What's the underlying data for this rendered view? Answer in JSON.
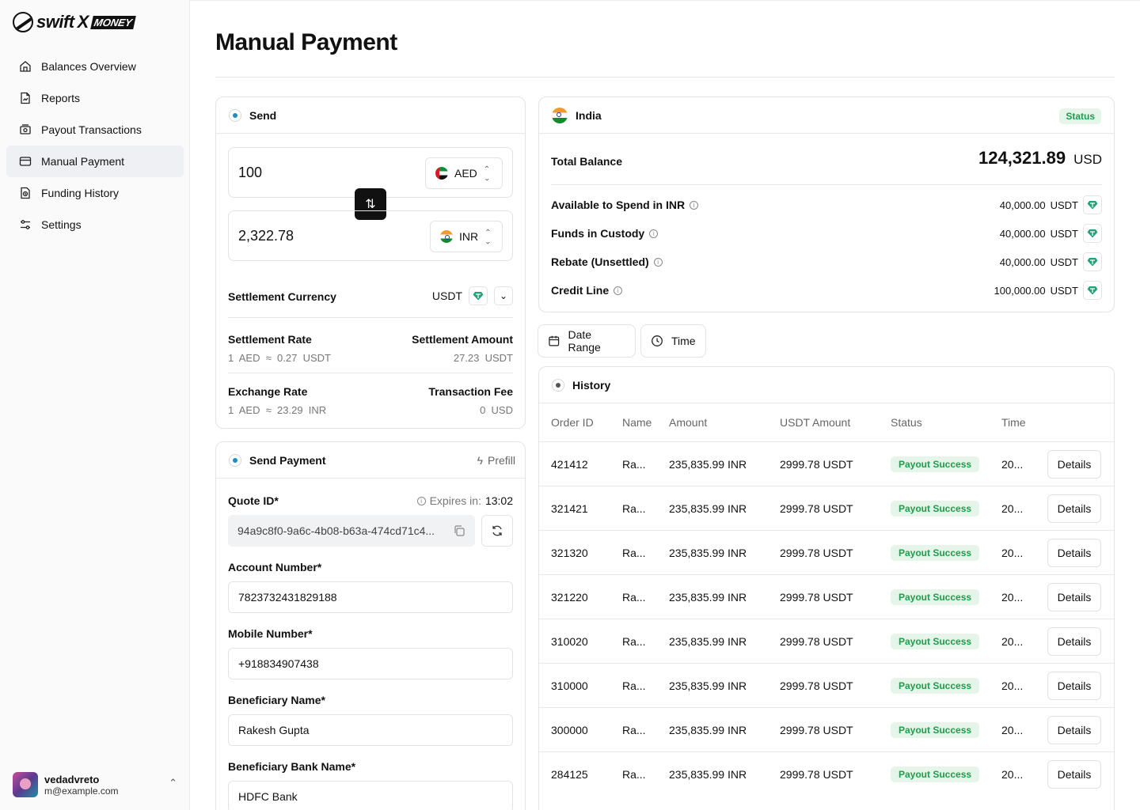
{
  "brand": {
    "name_prefix": "swift",
    "name_x": "X",
    "name_suffix": "MONEY"
  },
  "sidebar": {
    "items": [
      {
        "label": "Balances Overview",
        "icon": "home-icon"
      },
      {
        "label": "Reports",
        "icon": "report-icon"
      },
      {
        "label": "Payout Transactions",
        "icon": "payout-icon"
      },
      {
        "label": "Manual Payment",
        "icon": "card-icon",
        "active": true
      },
      {
        "label": "Funding History",
        "icon": "history-icon"
      },
      {
        "label": "Settings",
        "icon": "settings-icon"
      }
    ],
    "user": {
      "name": "vedadvreto",
      "email": "m@example.com"
    }
  },
  "page": {
    "title": "Manual Payment"
  },
  "send": {
    "header": "Send",
    "from_amount": "100",
    "from_currency": "AED",
    "to_amount": "2,322.78",
    "to_currency": "INR",
    "settlement_currency_label": "Settlement Currency",
    "settlement_currency": "USDT",
    "settlement_rate_label": "Settlement Rate",
    "settlement_rate": "1  AED  ≈  0.27  USDT",
    "settlement_amount_label": "Settlement Amount",
    "settlement_amount": "27.23  USDT",
    "exchange_rate_label": "Exchange Rate",
    "exchange_rate": "1  AED  ≈  23.29  INR",
    "transaction_fee_label": "Transaction Fee",
    "transaction_fee": "0  USD"
  },
  "send_payment": {
    "header": "Send Payment",
    "prefill": "Prefill",
    "quote_label": "Quote ID*",
    "expires_label": "Expires in:",
    "expires_value": "13:02",
    "quote_id": "94a9c8f0-9a6c-4b08-b63a-474cd71c4...",
    "account_label": "Account Number*",
    "account_value": "7823732431829188",
    "mobile_label": "Mobile Number*",
    "mobile_value": "+918834907438",
    "beneficiary_label": "Beneficiary Name*",
    "beneficiary_value": "Rakesh Gupta",
    "bank_label": "Beneficiary Bank Name*",
    "bank_value": "HDFC Bank"
  },
  "balance": {
    "country": "India",
    "status": "Status",
    "total_label": "Total Balance",
    "total_value": "124,321.89",
    "total_currency": "USD",
    "rows": [
      {
        "label": "Available to Spend in INR",
        "value": "40,000.00",
        "unit": "USDT"
      },
      {
        "label": "Funds in Custody",
        "value": "40,000.00",
        "unit": "USDT"
      },
      {
        "label": "Rebate (Unsettled)",
        "value": "40,000.00",
        "unit": "USDT"
      },
      {
        "label": "Credit Line",
        "value": "100,000.00",
        "unit": "USDT"
      }
    ]
  },
  "filters": {
    "date_range": "Date Range",
    "time": "Time"
  },
  "history": {
    "header": "History",
    "columns": [
      "Order ID",
      "Name",
      "Amount",
      "USDT Amount",
      "Status",
      "Time"
    ],
    "rows": [
      {
        "order": "421412",
        "name": "Ra...",
        "amount": "235,835.99 INR",
        "usdt": "2999.78 USDT",
        "status": "Payout Success",
        "time": "20...",
        "action": "Details"
      },
      {
        "order": "321421",
        "name": "Ra...",
        "amount": "235,835.99 INR",
        "usdt": "2999.78 USDT",
        "status": "Payout Success",
        "time": "20...",
        "action": "Details"
      },
      {
        "order": "321320",
        "name": "Ra...",
        "amount": "235,835.99 INR",
        "usdt": "2999.78 USDT",
        "status": "Payout Success",
        "time": "20...",
        "action": "Details"
      },
      {
        "order": "321220",
        "name": "Ra...",
        "amount": "235,835.99 INR",
        "usdt": "2999.78 USDT",
        "status": "Payout Success",
        "time": "20...",
        "action": "Details"
      },
      {
        "order": "310020",
        "name": "Ra...",
        "amount": "235,835.99 INR",
        "usdt": "2999.78 USDT",
        "status": "Payout Success",
        "time": "20...",
        "action": "Details"
      },
      {
        "order": "310000",
        "name": "Ra...",
        "amount": "235,835.99 INR",
        "usdt": "2999.78 USDT",
        "status": "Payout Success",
        "time": "20...",
        "action": "Details"
      },
      {
        "order": "300000",
        "name": "Ra...",
        "amount": "235,835.99 INR",
        "usdt": "2999.78 USDT",
        "status": "Payout Success",
        "time": "20...",
        "action": "Details"
      },
      {
        "order": "284125",
        "name": "Ra...",
        "amount": "235,835.99 INR",
        "usdt": "2999.78 USDT",
        "status": "Payout Success",
        "time": "20...",
        "action": "Details"
      }
    ]
  },
  "colors": {
    "accent": "#1b8ec4",
    "success_text": "#1f9b4c",
    "success_bg": "#e6f5ea",
    "usdt": "#26a17b"
  }
}
